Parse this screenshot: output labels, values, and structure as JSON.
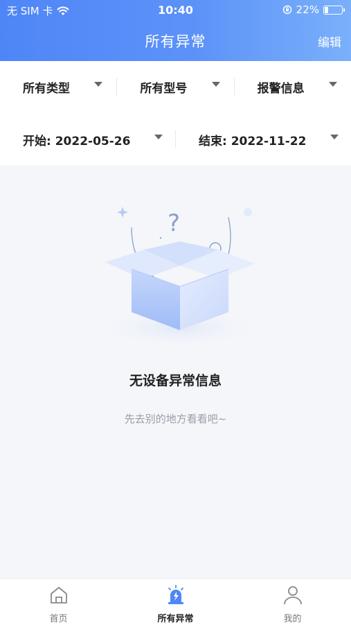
{
  "status_bar": {
    "carrier": "无 SIM 卡",
    "time": "10:40",
    "battery_percent": "22%",
    "battery_level": 0.22
  },
  "nav": {
    "title": "所有异常",
    "edit_label": "编辑"
  },
  "filters": {
    "type": "所有类型",
    "model": "所有型号",
    "alarm": "报警信息",
    "start": "开始: 2022-05-26",
    "end": "结束: 2022-11-22"
  },
  "empty_state": {
    "title": "无设备异常信息",
    "subtitle": "先去别的地方看看吧~"
  },
  "tabbar": {
    "items": [
      {
        "label": "首页",
        "icon": "home-icon",
        "active": false
      },
      {
        "label": "所有异常",
        "icon": "alarm-light-icon",
        "active": true
      },
      {
        "label": "我的",
        "icon": "user-icon",
        "active": false
      }
    ]
  },
  "colors": {
    "header_start": "#4f86f7",
    "header_end": "#7ab0fa",
    "accent": "#4f86f7",
    "background": "#f4f6fa"
  }
}
